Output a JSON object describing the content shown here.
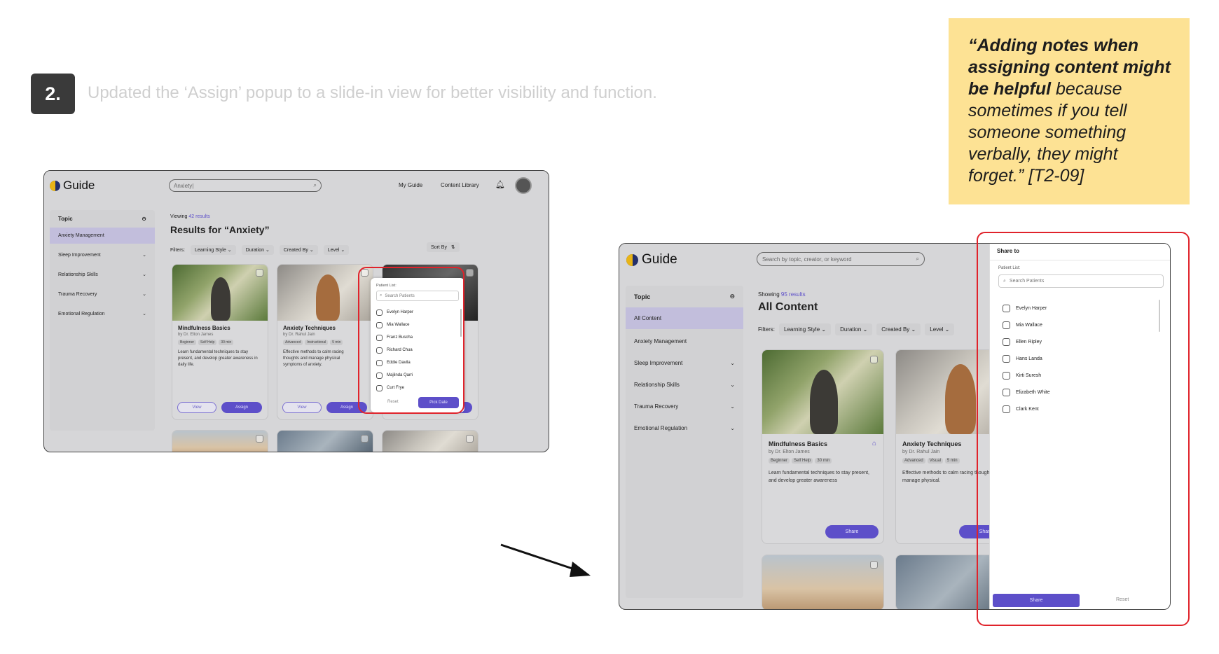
{
  "step": {
    "number": "2.",
    "caption": "Updated the ‘Assign’ popup to a slide-in view for better visibility and function."
  },
  "quote": {
    "bold": "“Adding notes when assigning content might be helpful",
    "rest": " because sometimes if you tell someone something verbally, they might forget.” [T2-09]"
  },
  "before": {
    "logo": "Guide",
    "search_value": "Anxiety|",
    "nav": [
      "My Guide",
      "Content Library"
    ],
    "sidebar": {
      "title": "Topic",
      "items": [
        "Anxiety Management",
        "Sleep Improvement",
        "Relationship Skills",
        "Trauma Recovery",
        "Emotional Regulation"
      ]
    },
    "viewing_prefix": "Viewing",
    "viewing_count": "42 results",
    "results_title": "Results for “Anxiety”",
    "filters_label": "Filters:",
    "filters": [
      "Learning Style",
      "Duration",
      "Created By",
      "Level"
    ],
    "sort_label": "Sort By",
    "cards": [
      {
        "title": "Mindfulness Basics",
        "author": "by Dr. Elton James",
        "tags": [
          "Beginner",
          "Self Help",
          "30 min"
        ],
        "desc": "Learn fundamental techniques to stay present, and develop greater awareness in daily life.",
        "view": "View",
        "assign": "Assign"
      },
      {
        "title": "Anxiety Techniques",
        "author": "by Dr. Rahul Jain",
        "tags": [
          "Advanced",
          "Instructional",
          "5 min"
        ],
        "desc": "Effective methods to calm racing thoughts and manage physical symptoms of anxiety.",
        "view": "View",
        "assign": "Assign"
      }
    ],
    "popup": {
      "label": "Patient List:",
      "search_placeholder": "Search Patients",
      "patients": [
        "Evelyn Harper",
        "Mia Wallace",
        "Franz Buscha",
        "Richard Chua",
        "Eddie Davila",
        "Majlinda Qarri",
        "Curt Frye"
      ],
      "reset": "Reset",
      "pick_date": "Pick Date"
    }
  },
  "after": {
    "logo": "Guide",
    "search_placeholder": "Search by topic, creator, or keyword",
    "sidebar": {
      "title": "Topic",
      "items": [
        "All Content",
        "Anxiety Management",
        "Sleep Improvement",
        "Relationship Skills",
        "Trauma Recovery",
        "Emotional Regulation"
      ]
    },
    "showing_prefix": "Showing",
    "showing_count": "95 results",
    "title": "All Content",
    "filters_label": "Filters:",
    "filters": [
      "Learning Style",
      "Duration",
      "Created By",
      "Level"
    ],
    "cards": [
      {
        "title": "Mindfulness Basics",
        "author": "by Dr. Elton James",
        "tags": [
          "Beginner",
          "Self Help",
          "30 min"
        ],
        "desc": "Learn fundamental techniques to stay present, and develop greater awareness",
        "share": "Share"
      },
      {
        "title": "Anxiety Techniques",
        "author": "by Dr. Rahul Jain",
        "tags": [
          "Advanced",
          "Visual",
          "5 min"
        ],
        "desc": "Effective methods to calm racing thoughts and manage physical.",
        "share": "Share"
      }
    ],
    "drawer": {
      "title": "Share to",
      "label": "Patient List:",
      "search_placeholder": "Search Patients",
      "patients": [
        "Evelyn Harper",
        "Mia Wallace",
        "Ellen Ripley",
        "Hans Landa",
        "Kirti Suresh",
        "Elizabeth White",
        "Clark Kent"
      ],
      "share": "Share",
      "reset": "Reset"
    }
  },
  "colors": {
    "accent": "#5d4fc9",
    "highlight": "#e0232b",
    "quote_bg": "#fde294"
  }
}
